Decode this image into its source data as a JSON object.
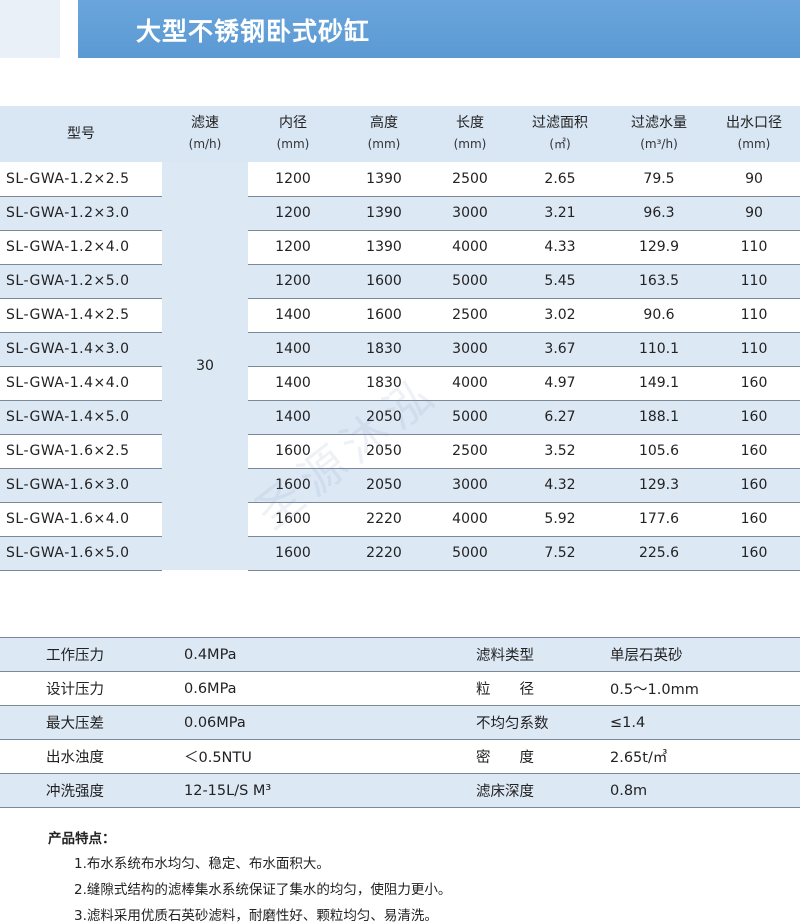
{
  "title": "大型不锈钢卧式砂缸",
  "spec": {
    "headers": [
      {
        "name": "型号",
        "unit": ""
      },
      {
        "name": "滤速",
        "unit": "(m/h)"
      },
      {
        "name": "内径",
        "unit": "(mm)"
      },
      {
        "name": "高度",
        "unit": "(mm)"
      },
      {
        "name": "长度",
        "unit": "(mm)"
      },
      {
        "name": "过滤面积",
        "unit": "(㎡)"
      },
      {
        "name": "过滤水量",
        "unit": "(m³/h)"
      },
      {
        "name": "出水口径",
        "unit": "(mm)"
      }
    ],
    "filter_speed": "30",
    "rows": [
      {
        "model": "SL-GWA-1.2×2.5",
        "diameter": "1200",
        "height": "1390",
        "length": "2500",
        "area": "2.65",
        "flow": "79.5",
        "outlet": "90"
      },
      {
        "model": "SL-GWA-1.2×3.0",
        "diameter": "1200",
        "height": "1390",
        "length": "3000",
        "area": "3.21",
        "flow": "96.3",
        "outlet": "90"
      },
      {
        "model": "SL-GWA-1.2×4.0",
        "diameter": "1200",
        "height": "1390",
        "length": "4000",
        "area": "4.33",
        "flow": "129.9",
        "outlet": "110"
      },
      {
        "model": "SL-GWA-1.2×5.0",
        "diameter": "1200",
        "height": "1600",
        "length": "5000",
        "area": "5.45",
        "flow": "163.5",
        "outlet": "110"
      },
      {
        "model": "SL-GWA-1.4×2.5",
        "diameter": "1400",
        "height": "1600",
        "length": "2500",
        "area": "3.02",
        "flow": "90.6",
        "outlet": "110"
      },
      {
        "model": "SL-GWA-1.4×3.0",
        "diameter": "1400",
        "height": "1830",
        "length": "3000",
        "area": "3.67",
        "flow": "110.1",
        "outlet": "110"
      },
      {
        "model": "SL-GWA-1.4×4.0",
        "diameter": "1400",
        "height": "1830",
        "length": "4000",
        "area": "4.97",
        "flow": "149.1",
        "outlet": "160"
      },
      {
        "model": "SL-GWA-1.4×5.0",
        "diameter": "1400",
        "height": "2050",
        "length": "5000",
        "area": "6.27",
        "flow": "188.1",
        "outlet": "160"
      },
      {
        "model": "SL-GWA-1.6×2.5",
        "diameter": "1600",
        "height": "2050",
        "length": "2500",
        "area": "3.52",
        "flow": "105.6",
        "outlet": "160"
      },
      {
        "model": "SL-GWA-1.6×3.0",
        "diameter": "1600",
        "height": "2050",
        "length": "3000",
        "area": "4.32",
        "flow": "129.3",
        "outlet": "160"
      },
      {
        "model": "SL-GWA-1.6×4.0",
        "diameter": "1600",
        "height": "2220",
        "length": "4000",
        "area": "5.92",
        "flow": "177.6",
        "outlet": "160"
      },
      {
        "model": "SL-GWA-1.6×5.0",
        "diameter": "1600",
        "height": "2220",
        "length": "5000",
        "area": "7.52",
        "flow": "225.6",
        "outlet": "160"
      }
    ]
  },
  "params": [
    {
      "k1": "工作压力",
      "v1": "0.4MPa",
      "k2": "滤料类型",
      "v2": "单层石英砂"
    },
    {
      "k1": "设计压力",
      "v1": "0.6MPa",
      "k2": "粒　　径",
      "v2": "0.5～1.0mm"
    },
    {
      "k1": "最大压差",
      "v1": "0.06MPa",
      "k2": "不均匀系数",
      "v2": "≤1.4"
    },
    {
      "k1": "出水浊度",
      "v1": "＜0.5NTU",
      "k2": "密　　度",
      "v2": "2.65t/㎥"
    },
    {
      "k1": "冲洗强度",
      "v1": "12-15L/S M³",
      "k2": "滤床深度",
      "v2": "0.8m"
    }
  ],
  "features": {
    "heading": "产品特点：",
    "items": [
      "1.布水系统布水均匀、稳定、布水面积大。",
      "2.缝隙式结构的滤棒集水系统保证了集水的均匀，使阻力更小。",
      "3.滤料采用优质石英砂滤料，耐磨性好、颗粒均匀、易清洗。"
    ]
  },
  "watermark": "圣源沐泓",
  "colors": {
    "title_bar": "#5b99d3",
    "row_stripe": "#dde8f5",
    "header_bg": "#d9e6f4"
  }
}
